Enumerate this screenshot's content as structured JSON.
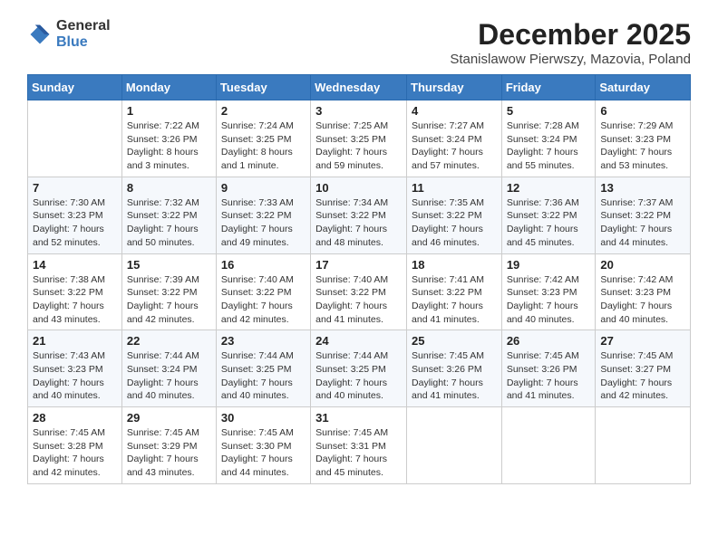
{
  "logo": {
    "general": "General",
    "blue": "Blue"
  },
  "header": {
    "month": "December 2025",
    "location": "Stanislawow Pierwszy, Mazovia, Poland"
  },
  "weekdays": [
    "Sunday",
    "Monday",
    "Tuesday",
    "Wednesday",
    "Thursday",
    "Friday",
    "Saturday"
  ],
  "weeks": [
    [
      {
        "day": "",
        "sunrise": "",
        "sunset": "",
        "daylight": ""
      },
      {
        "day": "1",
        "sunrise": "Sunrise: 7:22 AM",
        "sunset": "Sunset: 3:26 PM",
        "daylight": "Daylight: 8 hours and 3 minutes."
      },
      {
        "day": "2",
        "sunrise": "Sunrise: 7:24 AM",
        "sunset": "Sunset: 3:25 PM",
        "daylight": "Daylight: 8 hours and 1 minute."
      },
      {
        "day": "3",
        "sunrise": "Sunrise: 7:25 AM",
        "sunset": "Sunset: 3:25 PM",
        "daylight": "Daylight: 7 hours and 59 minutes."
      },
      {
        "day": "4",
        "sunrise": "Sunrise: 7:27 AM",
        "sunset": "Sunset: 3:24 PM",
        "daylight": "Daylight: 7 hours and 57 minutes."
      },
      {
        "day": "5",
        "sunrise": "Sunrise: 7:28 AM",
        "sunset": "Sunset: 3:24 PM",
        "daylight": "Daylight: 7 hours and 55 minutes."
      },
      {
        "day": "6",
        "sunrise": "Sunrise: 7:29 AM",
        "sunset": "Sunset: 3:23 PM",
        "daylight": "Daylight: 7 hours and 53 minutes."
      }
    ],
    [
      {
        "day": "7",
        "sunrise": "Sunrise: 7:30 AM",
        "sunset": "Sunset: 3:23 PM",
        "daylight": "Daylight: 7 hours and 52 minutes."
      },
      {
        "day": "8",
        "sunrise": "Sunrise: 7:32 AM",
        "sunset": "Sunset: 3:22 PM",
        "daylight": "Daylight: 7 hours and 50 minutes."
      },
      {
        "day": "9",
        "sunrise": "Sunrise: 7:33 AM",
        "sunset": "Sunset: 3:22 PM",
        "daylight": "Daylight: 7 hours and 49 minutes."
      },
      {
        "day": "10",
        "sunrise": "Sunrise: 7:34 AM",
        "sunset": "Sunset: 3:22 PM",
        "daylight": "Daylight: 7 hours and 48 minutes."
      },
      {
        "day": "11",
        "sunrise": "Sunrise: 7:35 AM",
        "sunset": "Sunset: 3:22 PM",
        "daylight": "Daylight: 7 hours and 46 minutes."
      },
      {
        "day": "12",
        "sunrise": "Sunrise: 7:36 AM",
        "sunset": "Sunset: 3:22 PM",
        "daylight": "Daylight: 7 hours and 45 minutes."
      },
      {
        "day": "13",
        "sunrise": "Sunrise: 7:37 AM",
        "sunset": "Sunset: 3:22 PM",
        "daylight": "Daylight: 7 hours and 44 minutes."
      }
    ],
    [
      {
        "day": "14",
        "sunrise": "Sunrise: 7:38 AM",
        "sunset": "Sunset: 3:22 PM",
        "daylight": "Daylight: 7 hours and 43 minutes."
      },
      {
        "day": "15",
        "sunrise": "Sunrise: 7:39 AM",
        "sunset": "Sunset: 3:22 PM",
        "daylight": "Daylight: 7 hours and 42 minutes."
      },
      {
        "day": "16",
        "sunrise": "Sunrise: 7:40 AM",
        "sunset": "Sunset: 3:22 PM",
        "daylight": "Daylight: 7 hours and 42 minutes."
      },
      {
        "day": "17",
        "sunrise": "Sunrise: 7:40 AM",
        "sunset": "Sunset: 3:22 PM",
        "daylight": "Daylight: 7 hours and 41 minutes."
      },
      {
        "day": "18",
        "sunrise": "Sunrise: 7:41 AM",
        "sunset": "Sunset: 3:22 PM",
        "daylight": "Daylight: 7 hours and 41 minutes."
      },
      {
        "day": "19",
        "sunrise": "Sunrise: 7:42 AM",
        "sunset": "Sunset: 3:23 PM",
        "daylight": "Daylight: 7 hours and 40 minutes."
      },
      {
        "day": "20",
        "sunrise": "Sunrise: 7:42 AM",
        "sunset": "Sunset: 3:23 PM",
        "daylight": "Daylight: 7 hours and 40 minutes."
      }
    ],
    [
      {
        "day": "21",
        "sunrise": "Sunrise: 7:43 AM",
        "sunset": "Sunset: 3:23 PM",
        "daylight": "Daylight: 7 hours and 40 minutes."
      },
      {
        "day": "22",
        "sunrise": "Sunrise: 7:44 AM",
        "sunset": "Sunset: 3:24 PM",
        "daylight": "Daylight: 7 hours and 40 minutes."
      },
      {
        "day": "23",
        "sunrise": "Sunrise: 7:44 AM",
        "sunset": "Sunset: 3:25 PM",
        "daylight": "Daylight: 7 hours and 40 minutes."
      },
      {
        "day": "24",
        "sunrise": "Sunrise: 7:44 AM",
        "sunset": "Sunset: 3:25 PM",
        "daylight": "Daylight: 7 hours and 40 minutes."
      },
      {
        "day": "25",
        "sunrise": "Sunrise: 7:45 AM",
        "sunset": "Sunset: 3:26 PM",
        "daylight": "Daylight: 7 hours and 41 minutes."
      },
      {
        "day": "26",
        "sunrise": "Sunrise: 7:45 AM",
        "sunset": "Sunset: 3:26 PM",
        "daylight": "Daylight: 7 hours and 41 minutes."
      },
      {
        "day": "27",
        "sunrise": "Sunrise: 7:45 AM",
        "sunset": "Sunset: 3:27 PM",
        "daylight": "Daylight: 7 hours and 42 minutes."
      }
    ],
    [
      {
        "day": "28",
        "sunrise": "Sunrise: 7:45 AM",
        "sunset": "Sunset: 3:28 PM",
        "daylight": "Daylight: 7 hours and 42 minutes."
      },
      {
        "day": "29",
        "sunrise": "Sunrise: 7:45 AM",
        "sunset": "Sunset: 3:29 PM",
        "daylight": "Daylight: 7 hours and 43 minutes."
      },
      {
        "day": "30",
        "sunrise": "Sunrise: 7:45 AM",
        "sunset": "Sunset: 3:30 PM",
        "daylight": "Daylight: 7 hours and 44 minutes."
      },
      {
        "day": "31",
        "sunrise": "Sunrise: 7:45 AM",
        "sunset": "Sunset: 3:31 PM",
        "daylight": "Daylight: 7 hours and 45 minutes."
      },
      {
        "day": "",
        "sunrise": "",
        "sunset": "",
        "daylight": ""
      },
      {
        "day": "",
        "sunrise": "",
        "sunset": "",
        "daylight": ""
      },
      {
        "day": "",
        "sunrise": "",
        "sunset": "",
        "daylight": ""
      }
    ]
  ]
}
